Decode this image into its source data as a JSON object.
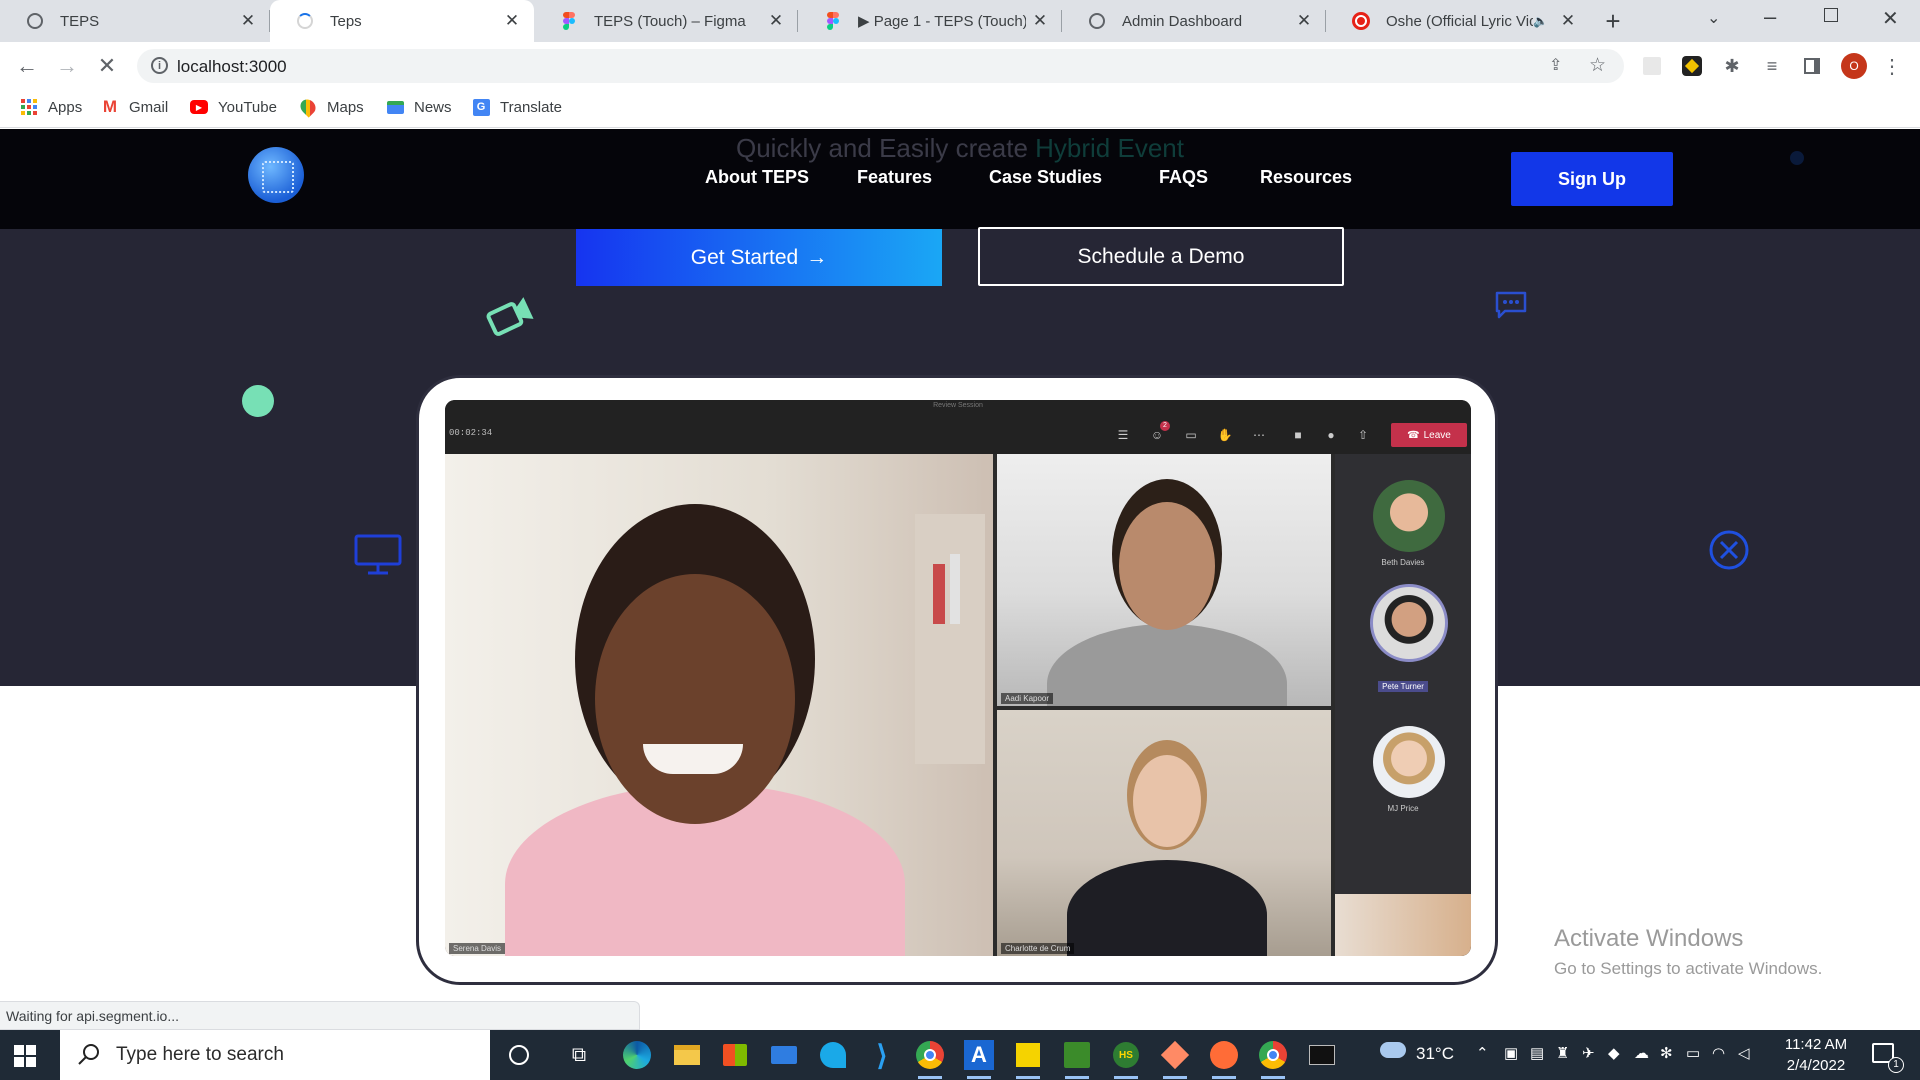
{
  "browser": {
    "tabs": [
      {
        "title": "TEPS",
        "icon": "globe-icon",
        "active": false
      },
      {
        "title": "Teps",
        "icon": "loading-spinner-icon",
        "active": true
      },
      {
        "title": "TEPS (Touch) – Figma",
        "icon": "figma-icon",
        "active": false
      },
      {
        "title": "▶ Page 1 - TEPS (Touch)",
        "icon": "figma-icon",
        "active": false
      },
      {
        "title": "Admin Dashboard",
        "icon": "globe-icon",
        "active": false
      },
      {
        "title": "Oshe (Official Lyric Vide",
        "icon": "youtube-icon",
        "active": false
      }
    ],
    "new_tab_symbol": "+",
    "url": "localhost:3000",
    "bookmarks": [
      {
        "label": "Apps",
        "icon": "apps-grid-icon"
      },
      {
        "label": "Gmail",
        "icon": "gmail-icon"
      },
      {
        "label": "YouTube",
        "icon": "youtube-icon"
      },
      {
        "label": "Maps",
        "icon": "maps-icon"
      },
      {
        "label": "News",
        "icon": "news-icon"
      },
      {
        "label": "Translate",
        "icon": "translate-icon"
      }
    ],
    "profile_initial": "O",
    "status_text": "Waiting for api.segment.io..."
  },
  "site": {
    "tagline_part1": "Quickly and Easily create",
    "tagline_highlight": "Hybrid Event",
    "nav": [
      "About TEPS",
      "Features",
      "Case Studies",
      "FAQS",
      "Resources"
    ],
    "signup_label": "Sign Up",
    "get_started_label": "Get Started",
    "get_started_arrow": "→",
    "demo_label": "Schedule a Demo",
    "call": {
      "session_title": "Review Session",
      "timer": "00:02:34",
      "leave_label": "Leave",
      "notification_count": "2",
      "participants_main": [
        {
          "name": "Serena Davis"
        },
        {
          "name": "Aadi Kapoor"
        },
        {
          "name": "Charlotte de Crum"
        }
      ],
      "roster": [
        {
          "name": "Beth Davies"
        },
        {
          "name": "Pete Turner"
        },
        {
          "name": "MJ Price"
        }
      ]
    }
  },
  "watermark": {
    "line1": "Activate Windows",
    "line2": "Go to Settings to activate Windows."
  },
  "taskbar": {
    "search_placeholder": "Type here to search",
    "temperature": "31°C",
    "time": "11:42 AM",
    "date": "2/4/2022",
    "notification_count": "1"
  },
  "colors": {
    "hero_bg": "#262635",
    "navbar_bg": "#05050a",
    "signup_bg": "#1237e8",
    "accent_green": "#77e0b5",
    "leave_red": "#c4314b"
  }
}
